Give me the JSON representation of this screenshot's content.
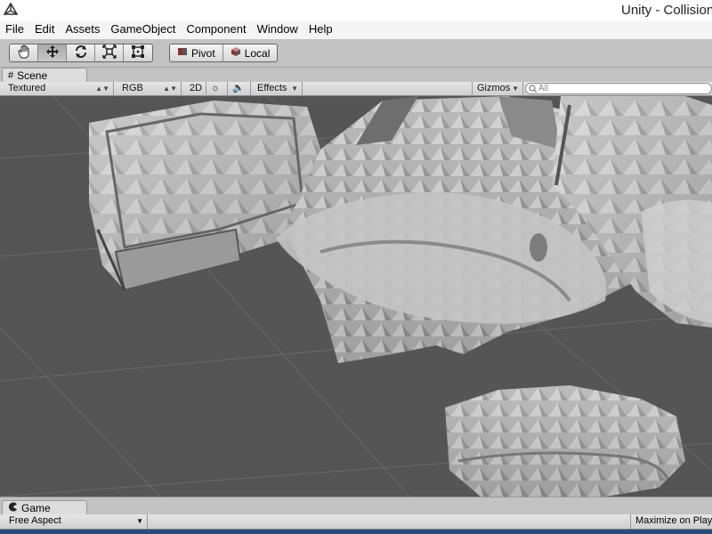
{
  "window": {
    "title": "Unity - Collision",
    "logo_icon": "unity-logo-icon"
  },
  "menu": [
    "File",
    "Edit",
    "Assets",
    "GameObject",
    "Component",
    "Window",
    "Help"
  ],
  "toolbar": {
    "tools": [
      {
        "name": "hand-tool",
        "icon": "hand-icon",
        "active": false
      },
      {
        "name": "move-tool",
        "icon": "move-icon",
        "active": true
      },
      {
        "name": "rotate-tool",
        "icon": "rotate-icon",
        "active": false
      },
      {
        "name": "scale-tool",
        "icon": "scale-icon",
        "active": false
      },
      {
        "name": "rect-tool",
        "icon": "rect-icon",
        "active": false
      }
    ],
    "pivot_label": "Pivot",
    "local_label": "Local"
  },
  "scene": {
    "tab_label": "Scene",
    "draw_mode": "Textured",
    "render_mode": "RGB",
    "mode_2d": "2D",
    "effects_label": "Effects",
    "gizmos_label": "Gizmos",
    "search_placeholder": "All"
  },
  "game": {
    "tab_label": "Game",
    "aspect": "Free Aspect",
    "maximize_label": "Maximize on Play"
  },
  "colors": {
    "viewport_bg": "#555555",
    "mesh": "#b9b9b9",
    "grid": "#6a6a6a",
    "taskbar": "#2b4a7a"
  }
}
